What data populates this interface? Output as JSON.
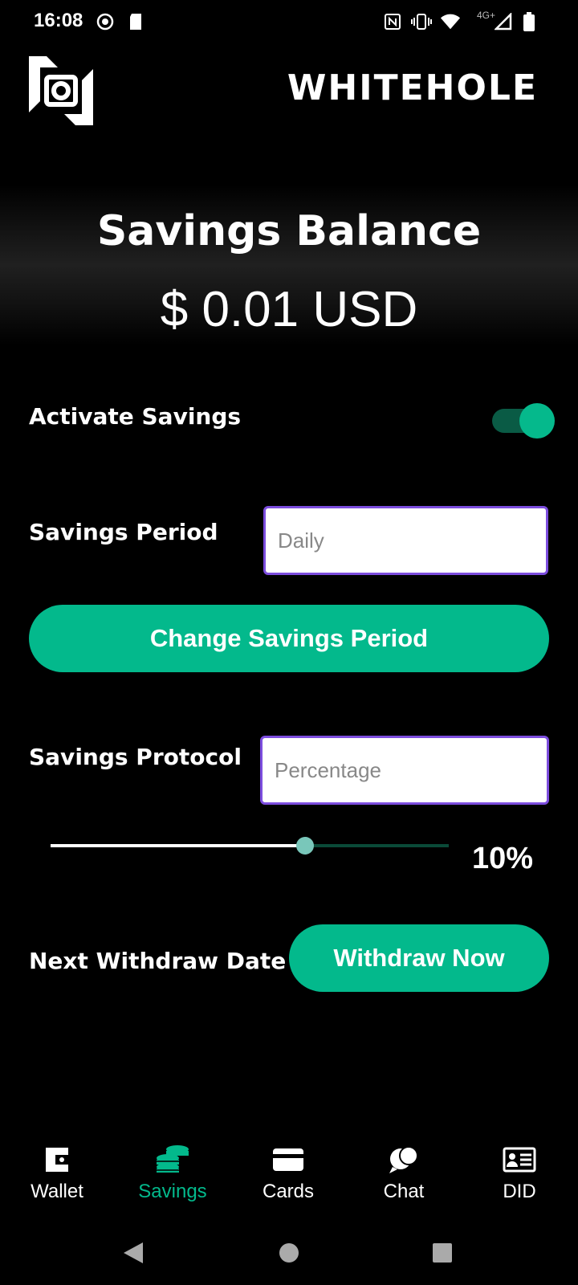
{
  "status_bar": {
    "time": "16:08",
    "network": "4G+"
  },
  "header": {
    "brand": "WHITEHOLE",
    "logo_icon": "whitehole-logo-icon"
  },
  "balance": {
    "title": "Savings Balance",
    "amount": "$ 0.01 USD"
  },
  "activate": {
    "label": "Activate Savings",
    "enabled": true
  },
  "period": {
    "label": "Savings Period",
    "placeholder": "Daily",
    "button_label": "Change Savings Period"
  },
  "protocol": {
    "label": "Savings Protocol",
    "placeholder": "Percentage",
    "slider_fraction": 0.64,
    "slider_value_label": "10%"
  },
  "withdraw": {
    "label": "Next Withdraw Date",
    "button_label": "Withdraw Now"
  },
  "bottom_nav": {
    "items": [
      {
        "label": "Wallet",
        "icon": "wallet-icon",
        "active": false
      },
      {
        "label": "Savings",
        "icon": "coins-icon",
        "active": true
      },
      {
        "label": "Cards",
        "icon": "card-icon",
        "active": false
      },
      {
        "label": "Chat",
        "icon": "chat-icon",
        "active": false
      },
      {
        "label": "DID",
        "icon": "id-card-icon",
        "active": false
      }
    ]
  },
  "colors": {
    "accent": "#03b98c",
    "input_border": "#7c4dde",
    "background": "#000000"
  }
}
